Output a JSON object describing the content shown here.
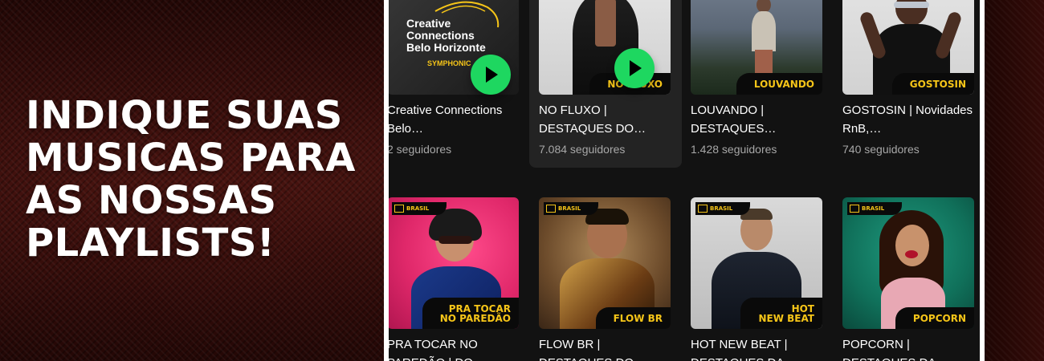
{
  "headline": {
    "lines": [
      "INDIQUE SUAS",
      "MUSICAS PARA",
      "AS NOSSAS",
      "PLAYLISTS!"
    ]
  },
  "cards_row1": [
    {
      "cover_lines": [
        "Creative",
        "Connections",
        "Belo Horizonte"
      ],
      "cover_sub": "SYMPHONIC",
      "title": "Creative Connections Belo…",
      "followers": "2 seguidores"
    },
    {
      "tag": "NO FLUXO",
      "title": "NO FLUXO | DESTAQUES DO…",
      "followers": "7.084 seguidores"
    },
    {
      "tag": "LOUVANDO",
      "title": "LOUVANDO | DESTAQUES…",
      "followers": "1.428 seguidores"
    },
    {
      "tag": "GOSTOSIN",
      "title": "GOSTOSIN | Novidades RnB,…",
      "followers": "740 seguidores"
    }
  ],
  "cards_row2": [
    {
      "badge": "BRASIL",
      "tag_lines": [
        "PRA TOCAR",
        "NO PAREDÃO"
      ],
      "title": "PRA TOCAR NO PAREDÃO | DO…"
    },
    {
      "badge": "BRASIL",
      "tag_lines": [
        "FLOW BR"
      ],
      "title": "FLOW BR | DESTAQUES DO…"
    },
    {
      "badge": "BRASIL",
      "tag_lines": [
        "HOT",
        "NEW BEAT"
      ],
      "title": "HOT NEW BEAT | DESTAQUES DA…"
    },
    {
      "badge": "BRASIL",
      "tag_lines": [
        "POPCORN"
      ],
      "title": "POPCORN | DESTAQUES DA…"
    }
  ],
  "colors": {
    "accent_green": "#1ed760",
    "tag_yellow": "#f6c518",
    "panel_bg": "#121212"
  },
  "icons": [
    "play-icon",
    "play-icon"
  ]
}
